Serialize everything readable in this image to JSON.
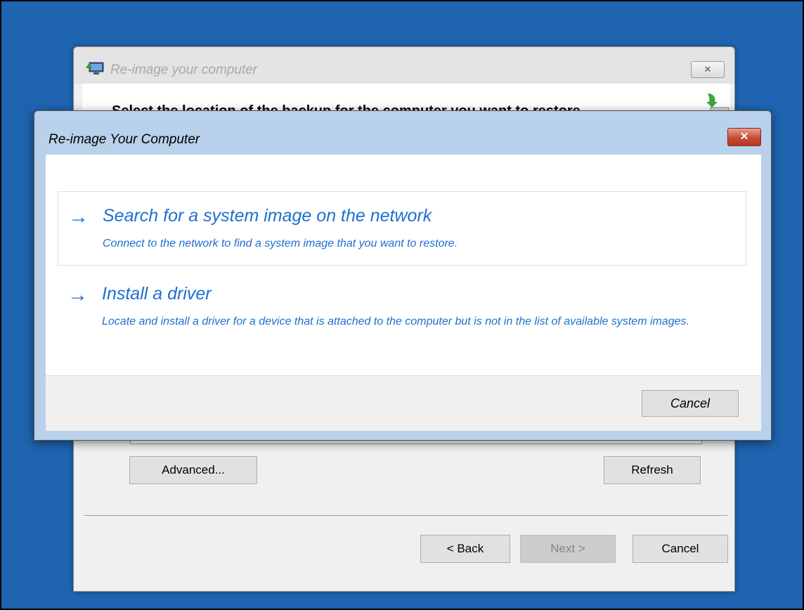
{
  "back_window": {
    "title": "Re-image your computer",
    "close_glyph": "✕",
    "heading": "Select the location of the backup for the computer you want to restore",
    "buttons": {
      "advanced": "Advanced...",
      "refresh": "Refresh",
      "back": "< Back",
      "next": "Next >",
      "cancel": "Cancel"
    }
  },
  "dialog": {
    "title": "Re-image Your Computer",
    "close_glyph": "✕",
    "options": [
      {
        "arrow": "→",
        "title": "Search for a system image on the network",
        "description": "Connect to the network to find a system image that you want to restore."
      },
      {
        "arrow": "→",
        "title": "Install a driver",
        "description": "Locate and install a driver for a device that is attached to the computer but is not in the list of available system images."
      }
    ],
    "cancel": "Cancel"
  },
  "colors": {
    "desktop": "#1f64b0",
    "link_blue": "#1e6fd0",
    "close_red": "#c74a34"
  },
  "icons": [
    "computer-restore-icon",
    "restore-arrow-icon",
    "close-icon",
    "arrow-right-icon"
  ]
}
